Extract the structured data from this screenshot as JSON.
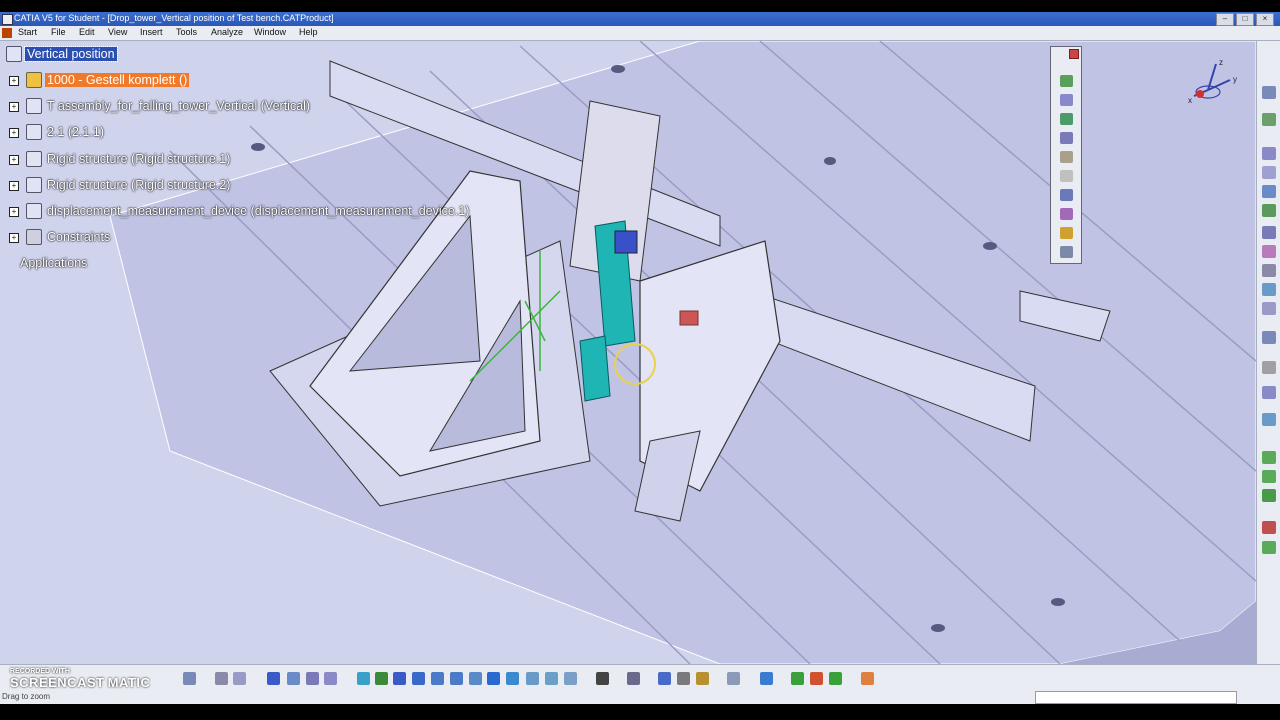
{
  "window": {
    "title": "CATIA V5 for Student - [Drop_tower_Vertical position of Test bench.CATProduct]",
    "buttons": [
      "–",
      "□",
      "×"
    ]
  },
  "menu": {
    "items": [
      "Start",
      "File",
      "Edit",
      "View",
      "Insert",
      "Tools",
      "Analyze",
      "Window",
      "Help"
    ]
  },
  "tree": {
    "root": "Vertical position",
    "nodes": [
      "1000 - Gestell komplett ()",
      "T assembly_for_falling_tower_Vertical (Vertical)",
      "2.1 (2.1.1)",
      "Rigid structure (Rigid structure.1)",
      "Rigid structure (Rigid structure.2)",
      "displacement_measurement_device (displacement_measurement_device.1)",
      "Constraints",
      "Applications"
    ]
  },
  "status": {
    "text": "Drag to zoom"
  },
  "watermark": {
    "small": "RECORDED WITH",
    "big": "SCREENCAST",
    "suffix": "MATIC"
  },
  "compass": {
    "axes": [
      "z",
      "y",
      "x"
    ]
  },
  "colors": {
    "viewport": "#cfd3ec",
    "selection": "#2a4fb0",
    "highlight": "#f07a2a",
    "cyan_part": "#1fb5b5"
  }
}
